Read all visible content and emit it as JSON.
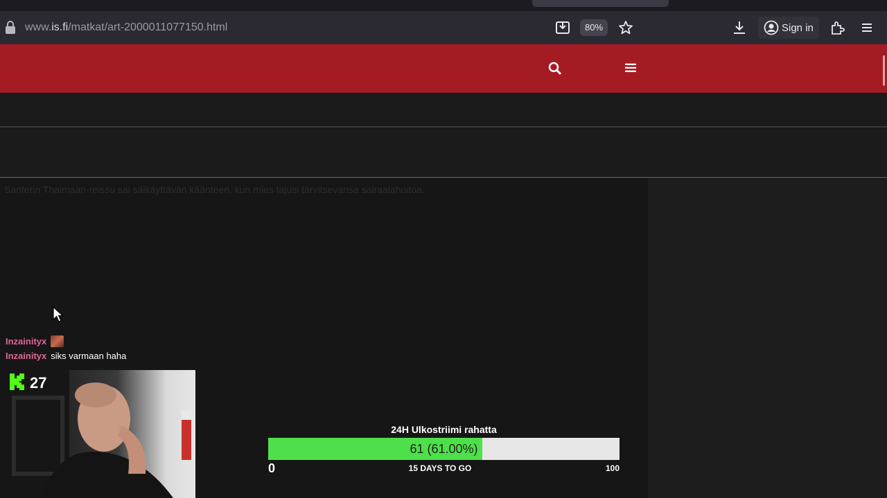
{
  "browser": {
    "url_prefix": "www.",
    "url_domain": "is.fi",
    "url_path": "/matkat/art-2000011077150.html",
    "zoom": "80%",
    "signin_label": "Sign in"
  },
  "article": {
    "lead": "Santerin Thaimaan-reissu sai säikäyttävän käänteen, kun mies tajusi tarvitsevansa sairaalahoitoa."
  },
  "chat": [
    {
      "user": "Inzainityx",
      "message": "",
      "emote": "emote"
    },
    {
      "user": "Inzainityx",
      "message": "siks varmaan haha"
    }
  ],
  "stream": {
    "viewer_count": "27"
  },
  "goal": {
    "title": "24H Ulkostriimi rahatta",
    "progress_text": "61 (61.00%)",
    "progress_fraction": 0.61,
    "min": "0",
    "max": "100",
    "days_left": "15 DAYS TO GO"
  },
  "colors": {
    "site_header": "#a51b24",
    "goal_fill": "#4ee04a",
    "kick_green": "#53fc18",
    "chat_user": "#e0679b"
  },
  "icons": [
    "lock-icon",
    "save-page-icon",
    "bookmark-star-icon",
    "download-icon",
    "account-icon",
    "extensions-icon",
    "menu-icon",
    "search-icon",
    "hamburger-icon",
    "cursor-icon",
    "kick-logo-icon"
  ]
}
